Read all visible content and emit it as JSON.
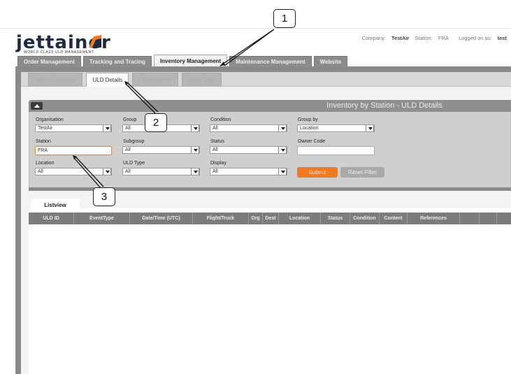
{
  "header": {
    "logo_text": "jettainer",
    "logo_tagline": "WORLD CLASS ULD MANAGEMENT",
    "company_label": "Company:",
    "company_value": "TestAir",
    "station_label": "Station:",
    "station_value": "FRA",
    "logged_label": "Logged on as:",
    "logged_value": "test"
  },
  "main_tabs": [
    {
      "label": "Order Management",
      "active": false
    },
    {
      "label": "Tracking and Tracing",
      "active": false
    },
    {
      "label": "Inventory Management",
      "active": true
    },
    {
      "label": "Maintenance Management",
      "active": false
    },
    {
      "label": "Website",
      "active": false
    }
  ],
  "sub_tabs": [
    {
      "label": "Station Overview",
      "active": false
    },
    {
      "label": "ULD Details",
      "active": true
    },
    {
      "label": "Flight/Vehicle",
      "active": false
    },
    {
      "label": "Stock Take",
      "active": false
    }
  ],
  "filter": {
    "title": "Inventory by Station - ULD Details",
    "organisation": {
      "label": "Organisation",
      "value": "TestAir"
    },
    "station": {
      "label": "Station",
      "value": "FRA"
    },
    "location": {
      "label": "Location",
      "value": "All"
    },
    "group": {
      "label": "Group",
      "value": "All"
    },
    "subgroup": {
      "label": "Subgroup",
      "value": "All"
    },
    "uld_type": {
      "label": "ULD Type",
      "value": "All"
    },
    "condition": {
      "label": "Condition",
      "value": "All"
    },
    "status": {
      "label": "Status",
      "value": "All"
    },
    "display": {
      "label": "Display",
      "value": "All"
    },
    "group_by": {
      "label": "Group by",
      "value": "Location"
    },
    "owner_code": {
      "label": "Owner Code",
      "value": ""
    },
    "submit_label": "Submit",
    "reset_label": "Reset Filter"
  },
  "list": {
    "tab_label": "Listview",
    "columns": [
      "ULD ID",
      "EventType",
      "Date/Time (UTC)",
      "Flight/Truck",
      "Org",
      "Dest",
      "Location",
      "Status",
      "Condition",
      "Content",
      "References",
      "",
      ""
    ]
  },
  "callouts": [
    "1",
    "2",
    "3"
  ],
  "colors": {
    "accent": "#f07a22",
    "header_gray": "#8f8f8f",
    "brand_navy": "#1f2a44"
  }
}
